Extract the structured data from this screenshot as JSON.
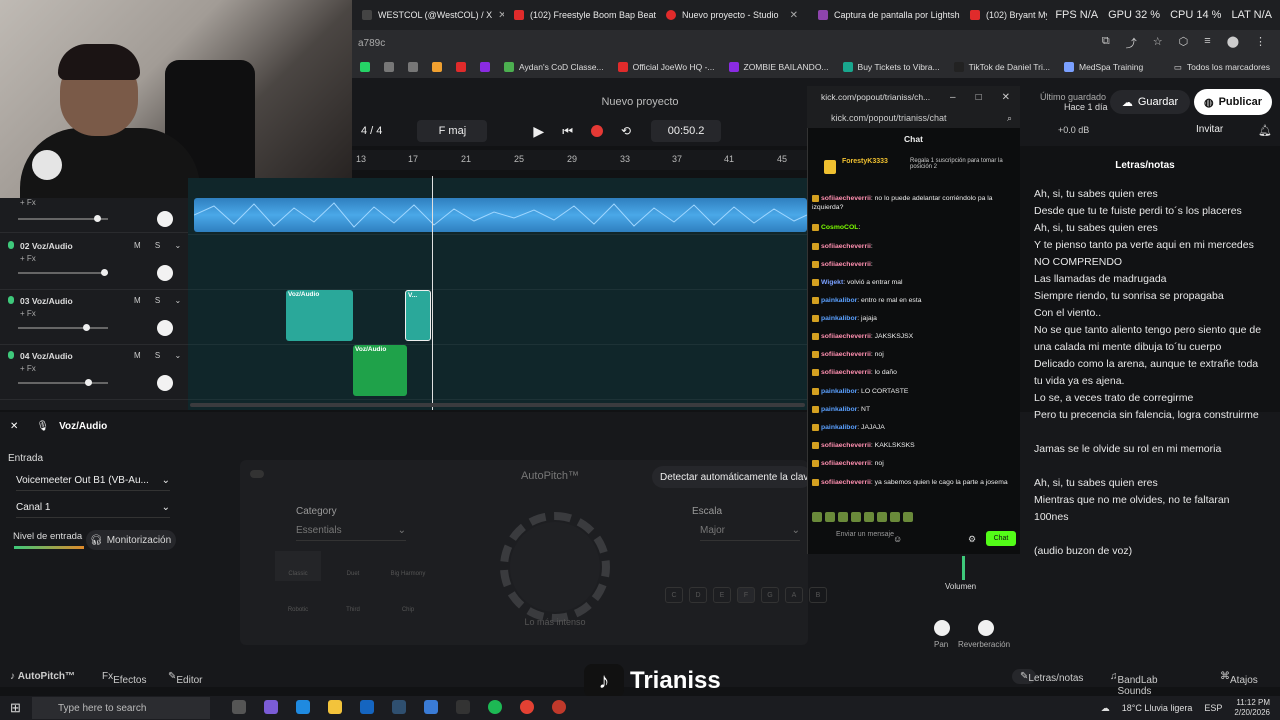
{
  "browser": {
    "tabs": [
      {
        "label": "WESTCOL (@WestCOL) / X",
        "color": "#444"
      },
      {
        "label": "(102) Freestyle Boom Bap Beat",
        "color": "#e02b2b"
      },
      {
        "label": "Nuevo proyecto - Studio",
        "color": "#e02b2b"
      },
      {
        "label": "Captura de pantalla por Lightshot",
        "color": "#8e44ad"
      },
      {
        "label": "(102) Bryant Myers x Omar Courtz",
        "color": "#e02b2b"
      }
    ],
    "stats": {
      "gpu": "GPU 32 %",
      "cpu": "CPU 14 %",
      "lat": "LAT N/A",
      "fps": "FPS N/A"
    },
    "url_fragment": "a789c",
    "bookmarks": [
      "Aydan's CoD Classe...",
      "Official JoeWo HQ -...",
      "ZOMBIE BAILANDO...",
      "Buy Tickets to Vibra...",
      "TikTok de Daniel Tri...",
      "MedSpa Training",
      "Todos los marcadores"
    ]
  },
  "app": {
    "project_title": "Nuevo proyecto",
    "time_signature": "4 / 4",
    "key": "F maj",
    "time": "00:50.2",
    "last_saved_label": "Último guardado",
    "last_saved_value": "Hace 1 día",
    "save_label": "Guardar",
    "publish_label": "Publicar",
    "invite_label": "Invitar",
    "db": "+0.0 dB",
    "ruler": [
      "13",
      "17",
      "21",
      "25",
      "29",
      "33",
      "37",
      "41",
      "45"
    ]
  },
  "tracks": [
    {
      "name": "",
      "fx": "+ Fx",
      "level": 0.52
    },
    {
      "name": "02  Voz/Audio",
      "fx": "+ Fx",
      "level": 0.56
    },
    {
      "name": "03  Voz/Audio",
      "fx": "+ Fx",
      "level": 0.45
    },
    {
      "name": "04  Voz/Audio",
      "fx": "+ Fx",
      "level": 0.47
    }
  ],
  "clips": {
    "label": "Voz/Audio",
    "short_label": "V..."
  },
  "panel": {
    "track_title": "Voz/Audio",
    "entrada_label": "Entrada",
    "input_device": "Voicemeeter Out B1 (VB-Au...",
    "channel": "Canal 1",
    "nivel_label": "Nivel de entrada",
    "monitor_label": "Monitorización",
    "autopitch_title": "AutoPitch™",
    "detect_label": "Detectar automáticamente la clave",
    "category_label": "Category",
    "category_value": "Essentials",
    "escala_label": "Escala",
    "escala_value": "Major",
    "dial_caption": "Lo más intenso",
    "tiles": [
      "Classic",
      "Duet",
      "Big Harmony",
      "Robotic",
      "Third",
      "Chip"
    ],
    "keys": [
      "C",
      "D",
      "E",
      "F",
      "G",
      "A",
      "B"
    ]
  },
  "chat": {
    "window_url": "kick.com/popout/trianiss/ch...",
    "url": "kick.com/popout/trianiss/chat",
    "title": "Chat",
    "pinned_user": "ForestyK3333",
    "pinned_text": "Regala 1 suscripción para tomar la posición 2",
    "messages": [
      {
        "user": "sofiiaecheverrii",
        "color": "#ff8fb0",
        "text": "no lo puede adelantar corriéndolo pa la izquierda?"
      },
      {
        "user": "CosmoCOL",
        "color": "#7cfc00",
        "text": ""
      },
      {
        "user": "sofiiaecheverrii",
        "color": "#ff8fb0",
        "text": ""
      },
      {
        "user": "sofiiaecheverrii",
        "color": "#ff8fb0",
        "text": ""
      },
      {
        "user": "Wigekt",
        "color": "#7aa0ff",
        "text": "volvió a entrar mal"
      },
      {
        "user": "painkalibor",
        "color": "#5aa0ff",
        "text": "entro re mal en esta"
      },
      {
        "user": "painkalibor",
        "color": "#5aa0ff",
        "text": "jajaja"
      },
      {
        "user": "sofiiaecheverrii",
        "color": "#ff8fb0",
        "text": "JAKSKSJSX"
      },
      {
        "user": "sofiiaecheverrii",
        "color": "#ff8fb0",
        "text": "noj"
      },
      {
        "user": "sofiiaecheverrii",
        "color": "#ff8fb0",
        "text": "lo daño"
      },
      {
        "user": "painkalibor",
        "color": "#5aa0ff",
        "text": "LO CORTASTE"
      },
      {
        "user": "painkalibor",
        "color": "#5aa0ff",
        "text": "NT"
      },
      {
        "user": "painkalibor",
        "color": "#5aa0ff",
        "text": "JAJAJA"
      },
      {
        "user": "sofiiaecheverrii",
        "color": "#ff8fb0",
        "text": "KAKLSKSKS"
      },
      {
        "user": "sofiiaecheverrii",
        "color": "#ff8fb0",
        "text": "noj"
      },
      {
        "user": "sofiiaecheverrii",
        "color": "#ff8fb0",
        "text": "ya sabemos quien le cago la parte a josema"
      }
    ],
    "input_placeholder": "Enviar un mensaje",
    "send_label": "Chat"
  },
  "lyrics": {
    "title": "Letras/notas",
    "lines": [
      "Ah, si, tu sabes quien eres",
      "Desde que tu te fuiste perdi to´s los placeres",
      "Ah, si, tu sabes quien eres",
      "Y te pienso tanto pa verte aqui en mi mercedes",
      "NO COMPRENDO",
      "Las llamadas de madrugada",
      "Siempre riendo, tu sonrisa se propagaba",
      "Con el viento..",
      "No se que tanto aliento tengo pero siento que de una calada mi mente dibuja to´tu cuerpo",
      "Delicado como la arena, aunque te extrañe toda tu vida ya es ajena.",
      "Lo se, a veces trato de corregirme",
      "Pero tu precencia sin falencia, logra construirme",
      "",
      "Jamas se le olvide su rol en mi memoria",
      "",
      "Ah, si, tu sabes quien eres",
      "Mientras que no me olvides, no te faltaran 100nes",
      "",
      "(audio buzon de voz)"
    ]
  },
  "mixer": {
    "volume_label": "Volumen",
    "pan_label": "Pan",
    "reverb_label": "Reverberación"
  },
  "footer": {
    "autopitch": "AutoPitch™",
    "efectos": "Efectos",
    "editor": "Editor",
    "letras": "Letras/notas",
    "sounds": "BandLab Sounds",
    "atajos": "Atajos"
  },
  "watermark": {
    "name": "Trianiss"
  },
  "taskbar": {
    "search_placeholder": "Type here to search",
    "weather": "18°C  Lluvia ligera",
    "lang": "ESP",
    "time": "11:12 PM",
    "date": "2/20/2026"
  }
}
